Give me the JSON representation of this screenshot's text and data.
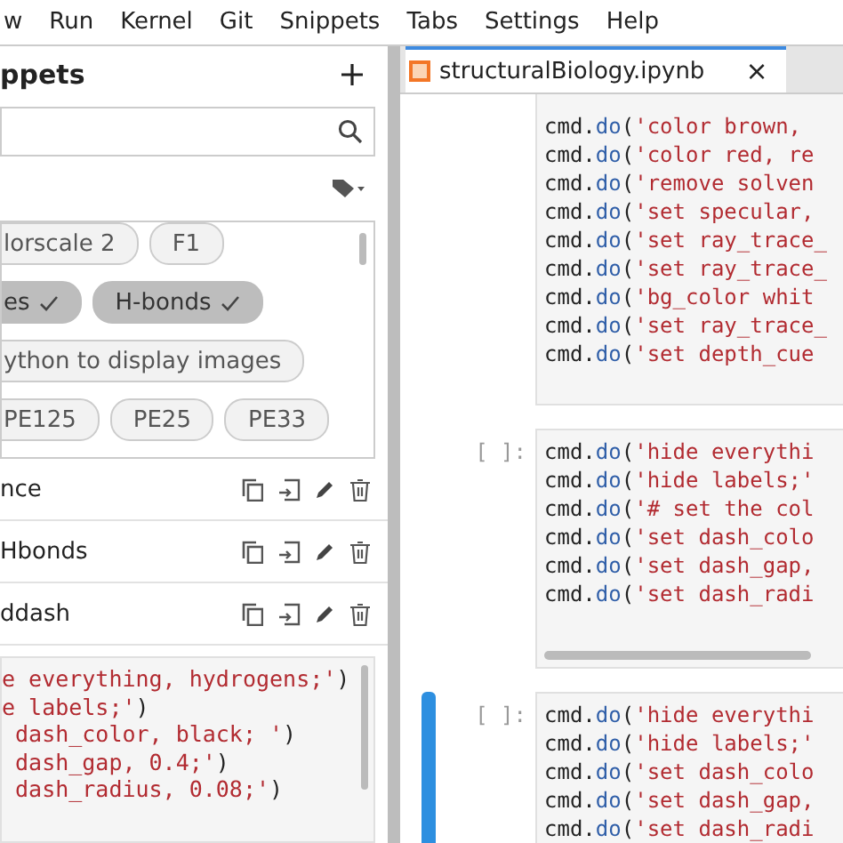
{
  "menu": [
    "w",
    "Run",
    "Kernel",
    "Git",
    "Snippets",
    "Tabs",
    "Settings",
    "Help"
  ],
  "snippets_panel": {
    "title": "ppets",
    "tags": [
      [
        {
          "label": "lorscale 2",
          "selected": false
        },
        {
          "label": "F1",
          "selected": false
        }
      ],
      [
        {
          "label": "es",
          "selected": true
        },
        {
          "label": "H-bonds",
          "selected": true
        }
      ],
      [
        {
          "label": "ython to display images",
          "selected": false
        }
      ],
      [
        {
          "label": "PE125",
          "selected": false
        },
        {
          "label": "PE25",
          "selected": false
        },
        {
          "label": "PE33",
          "selected": false
        }
      ]
    ],
    "items": [
      {
        "name": "nce"
      },
      {
        "name": "Hbonds"
      },
      {
        "name": "ddash"
      }
    ],
    "preview": [
      {
        "string": "e everything, hydrogens;'",
        "close": ")"
      },
      {
        "string": "e labels;'",
        "close": ")"
      },
      {
        "string": " dash_color, black; '",
        "close": ")"
      },
      {
        "string": " dash_gap, 0.4;'",
        "close": ")"
      },
      {
        "string": " dash_radius, 0.08;'",
        "close": ")"
      }
    ]
  },
  "notebook": {
    "tab": {
      "title": "structuralBiology.ipynb",
      "close": "×"
    },
    "cells": [
      {
        "selected": false,
        "hscroll": false,
        "lines": [
          {
            "object": "cmd.",
            "method": "do",
            "paren": "(",
            "string": "'color brown,"
          },
          {
            "object": "cmd.",
            "method": "do",
            "paren": "(",
            "string": "'color red, re"
          },
          {
            "object": "cmd.",
            "method": "do",
            "paren": "(",
            "string": "'remove solven"
          },
          {
            "object": "cmd.",
            "method": "do",
            "paren": "(",
            "string": "'set specular,"
          },
          {
            "object": "cmd.",
            "method": "do",
            "paren": "(",
            "string": "'set ray_trace_"
          },
          {
            "object": "cmd.",
            "method": "do",
            "paren": "(",
            "string": "'set ray_trace_"
          },
          {
            "object": "cmd.",
            "method": "do",
            "paren": "(",
            "string": "'bg_color whit"
          },
          {
            "object": "cmd.",
            "method": "do",
            "paren": "(",
            "string": "'set ray_trace_"
          },
          {
            "object": "cmd.",
            "method": "do",
            "paren": "(",
            "string": "'set depth_cue"
          }
        ]
      },
      {
        "prompt": "[ ]:",
        "selected": false,
        "hscroll": true,
        "lines": [
          {
            "object": "cmd.",
            "method": "do",
            "paren": "(",
            "string": "'hide everythi"
          },
          {
            "object": "cmd.",
            "method": "do",
            "paren": "(",
            "string": "'hide labels;'"
          },
          {
            "object": "cmd.",
            "method": "do",
            "paren": "(",
            "string": "'# set the col"
          },
          {
            "object": "cmd.",
            "method": "do",
            "paren": "(",
            "string": "'set dash_colo"
          },
          {
            "object": "cmd.",
            "method": "do",
            "paren": "(",
            "string": "'set dash_gap,"
          },
          {
            "object": "cmd.",
            "method": "do",
            "paren": "(",
            "string": "'set dash_radi"
          }
        ]
      },
      {
        "prompt": "[ ]:",
        "selected": true,
        "hscroll": false,
        "lines": [
          {
            "object": "cmd.",
            "method": "do",
            "paren": "(",
            "string": "'hide everythi"
          },
          {
            "object": "cmd.",
            "method": "do",
            "paren": "(",
            "string": "'hide labels;'"
          },
          {
            "object": "cmd.",
            "method": "do",
            "paren": "(",
            "string": "'set dash_colo"
          },
          {
            "object": "cmd.",
            "method": "do",
            "paren": "(",
            "string": "'set dash_gap,"
          },
          {
            "object": "cmd.",
            "method": "do",
            "paren": "(",
            "string": "'set dash_radi"
          }
        ]
      }
    ]
  }
}
